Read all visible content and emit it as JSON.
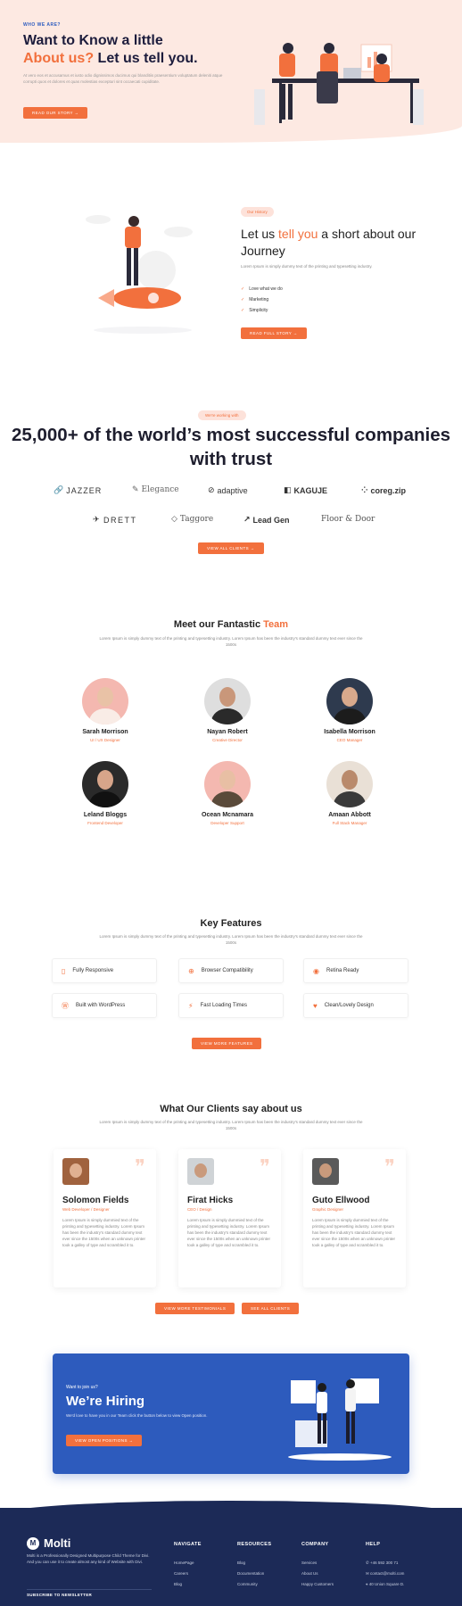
{
  "hero": {
    "kicker": "WHO WE ARE?",
    "title_line1": "Want to Know a little",
    "title_accent": "About us?",
    "title_rest": " Let us tell you.",
    "desc": "At vero eos et accusamus et iusto odio dignissimos ducimus qui blanditiis praesentium voluptatum deleniti atque corrupti quos et dolores et quas molestias excepturi sint occaecati cupiditate.",
    "button": "READ OUR STORY →"
  },
  "journey": {
    "pill": "Our History",
    "title_pre": "Let us ",
    "title_accent": "tell you",
    "title_post": " a short about our Journey",
    "desc": "Lorem Ipsum is simply dummy text of the printing and typesetting industry.",
    "items": [
      "Love what we do",
      "Marketing",
      "Simplicity"
    ],
    "button": "READ FULL STORY →"
  },
  "companies": {
    "pill": "We're working with",
    "title": "25,000+ of the world’s most successful companies with trust",
    "logos_row1": [
      {
        "icon": "link-icon",
        "glyph": "🔗",
        "name": "JAZZER"
      },
      {
        "icon": "feather-icon",
        "glyph": "✎",
        "name": "Elegance"
      },
      {
        "icon": "adaptive-icon",
        "glyph": "⊘",
        "name": "adaptive"
      },
      {
        "icon": "kaguje-icon",
        "glyph": "◧",
        "name": "KAGUJE"
      },
      {
        "icon": "dots-icon",
        "glyph": "⁘",
        "name": "coreg.zip"
      }
    ],
    "logos_row2": [
      {
        "icon": "plane-icon",
        "glyph": "✈",
        "name": "DRETT"
      },
      {
        "icon": "tag-icon",
        "glyph": "◇",
        "name": "Taggore"
      },
      {
        "icon": "arrow-icon",
        "glyph": "↗",
        "name": "Lead Gen"
      },
      {
        "icon": "none",
        "glyph": "",
        "name": "Floor & Door"
      }
    ],
    "button": "VIEW ALL CLIENTS →"
  },
  "team": {
    "title_pre": "Meet our Fantastic ",
    "title_accent": "Team",
    "desc": "Lorem Ipsum is simply dummy text of the printing and typesetting industry. Lorem Ipsum has been the industry's standard dummy text ever since the 1500s",
    "members": [
      {
        "name": "Sarah Morrison",
        "role": "UI / UX Designer"
      },
      {
        "name": "Nayan Robert",
        "role": "Creative Director"
      },
      {
        "name": "Isabella Morrison",
        "role": "CEO Manager"
      },
      {
        "name": "Leland Bloggs",
        "role": "Frontend Developer"
      },
      {
        "name": "Ocean Mcnamara",
        "role": "Developer Support"
      },
      {
        "name": "Amaan Abbott",
        "role": "Full Stack Manager"
      }
    ]
  },
  "features": {
    "title": "Key Features",
    "desc": "Lorem Ipsum is simply dummy text of the printing and typesetting industry. Lorem Ipsum has been the industry's standard dummy text ever since the 1500s",
    "items": [
      {
        "icon": "mobile-icon",
        "glyph": "▯",
        "label": "Fully Responsive"
      },
      {
        "icon": "browser-icon",
        "glyph": "⊕",
        "label": "Browser Compatibility"
      },
      {
        "icon": "eye-icon",
        "glyph": "◉",
        "label": "Retina Ready"
      },
      {
        "icon": "wordpress-icon",
        "glyph": "Ⓦ",
        "label": "Built with WordPress"
      },
      {
        "icon": "bolt-icon",
        "glyph": "⚡",
        "label": "Fast Loading Times"
      },
      {
        "icon": "heart-icon",
        "glyph": "♥",
        "label": "Clean/Lovely Design"
      }
    ],
    "button": "VIEW MORE FEATURES"
  },
  "testimonials": {
    "title": "What Our Clients say about us",
    "desc": "Lorem Ipsum is simply dummy text of the printing and typesetting industry. Lorem Ipsum has been the industry's standard dummy text ever since the 1500s",
    "items": [
      {
        "name": "Solomon Fields",
        "role": "Web Developer / Designer",
        "text": "Lorem Ipsum is simply dummied text of the printing and typesetting industry. Lorem Ipsum has been the industry's standard dummy text ever since the 1500s when an unknown printer took a galley of type and scrambled it to."
      },
      {
        "name": "Firat Hicks",
        "role": "CEO / Design",
        "text": "Lorem Ipsum is simply dummied text of the printing and typesetting industry. Lorem Ipsum has been the industry's standard dummy text ever since the 1500s when an unknown printer took a galley of type and scrambled it to."
      },
      {
        "name": "Guto Ellwood",
        "role": "Graphic Designer",
        "text": "Lorem Ipsum is simply dummied text of the printing and typesetting industry. Lorem Ipsum has been the industry's standard dummy text ever since the 1500s when an unknown printer took a galley of type and scrambled it to."
      }
    ],
    "button_more": "VIEW MORE TESTIMONIALS",
    "button_clients": "SEE ALL CLIENTS"
  },
  "hiring": {
    "kicker": "Want to join us?",
    "title": "We’re Hiring",
    "desc": "We'd love to have you in our Team click the button below to view Open position.",
    "button": "VIEW OPEN POSITIONS →"
  },
  "footer": {
    "brand": "Molti",
    "brand_desc": "Molti is a Professionally Designed Multipurpose Child Theme for Divi. And you can use it to create almost any kind of Website with Divi.",
    "subscribe": "SUBSCRIBE TO NEWSLETTER",
    "columns": [
      {
        "heading": "NAVIGATE",
        "items": [
          "HomePage",
          "Careers",
          "Blog"
        ]
      },
      {
        "heading": "RESOURCES",
        "items": [
          "Blog",
          "Documentation",
          "Community"
        ]
      },
      {
        "heading": "COMPANY",
        "items": [
          "Services",
          "About Us",
          "Happy Customers"
        ]
      },
      {
        "heading": "HELP",
        "items": [
          "+46 592 300 71",
          "contact@molti.com",
          "40 Union Square D."
        ]
      }
    ]
  },
  "colors": {
    "accent": "#f2703d",
    "blue": "#2d5bbd",
    "footer": "#1c2a57"
  }
}
